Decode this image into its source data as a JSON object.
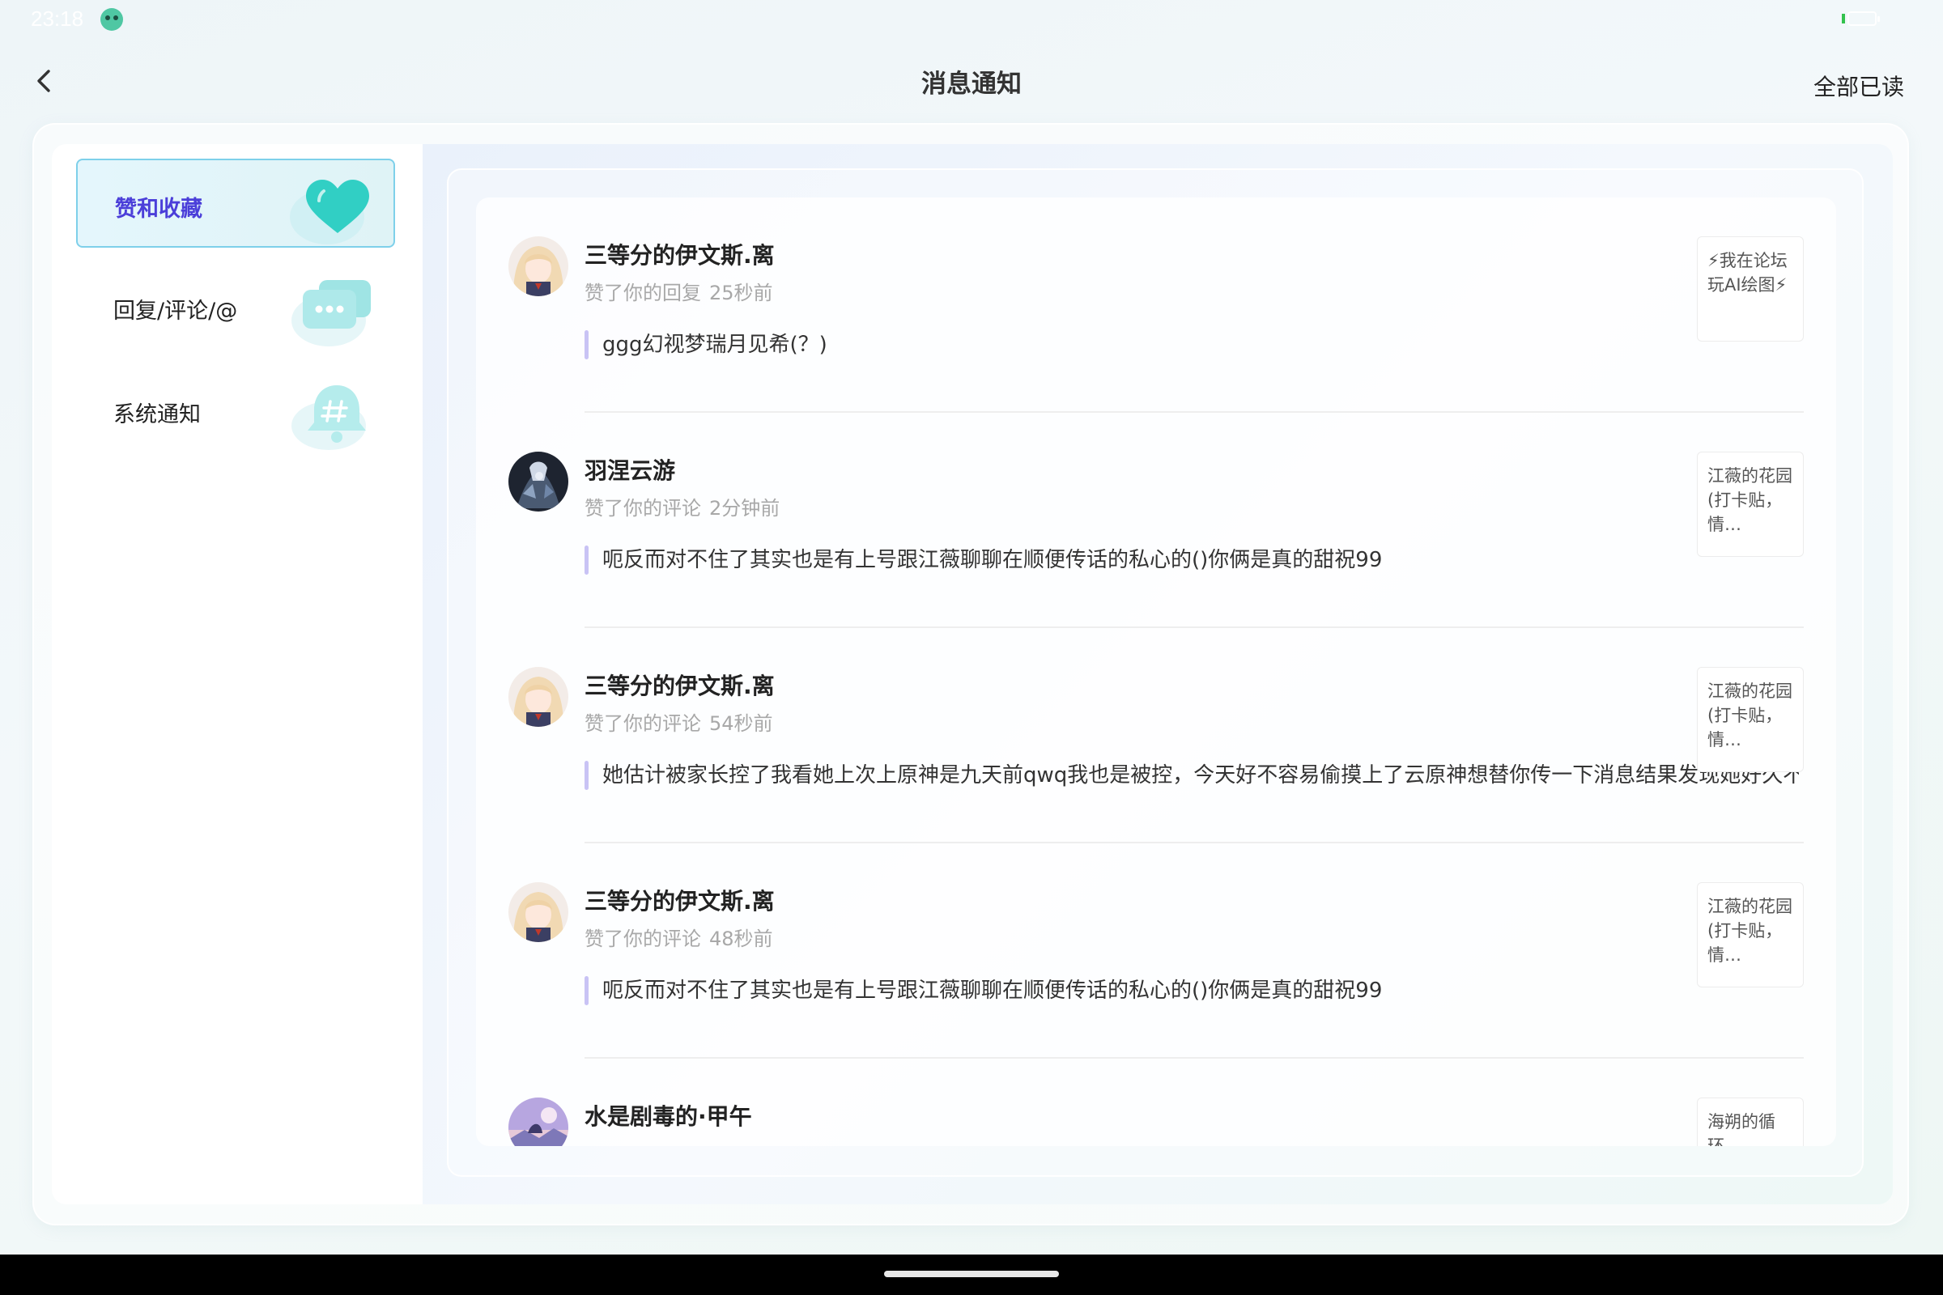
{
  "status_bar": {
    "time": "23:18",
    "app_icon": "green-monster-app-icon",
    "battery_icon": "battery-icon"
  },
  "header": {
    "back_icon": "chevron-left-icon",
    "title": "消息通知",
    "mark_all_read": "全部已读"
  },
  "sidebar": {
    "items": [
      {
        "label": "赞和收藏",
        "icon": "heart-icon",
        "active": true
      },
      {
        "label": "回复/评论/@",
        "icon": "chat-bubbles-icon",
        "active": false
      },
      {
        "label": "系统通知",
        "icon": "bell-icon",
        "active": false
      }
    ]
  },
  "notifications": [
    {
      "user": "三等分的伊文斯.离",
      "action": "赞了你的回复",
      "time": "25秒前",
      "content": "ggg幻视梦瑞月见希(？)",
      "post": "⚡我在论坛玩AI绘图⚡",
      "avatar": "anime-girl-avatar"
    },
    {
      "user": "羽涅云游",
      "action": "赞了你的评论",
      "time": "2分钟前",
      "content": "呃反而对不住了其实也是有上号跟江薇聊聊在顺便传话的私心的()你俩是真的甜祝99",
      "post": "江薇的花园(打卡贴，情…",
      "avatar": "dark-character-avatar"
    },
    {
      "user": "三等分的伊文斯.离",
      "action": "赞了你的评论",
      "time": "54秒前",
      "content": "她估计被家长控了我看她上次上原神是九天前qwq我也是被控，今天好不容易偷摸上了云原神想替你传一下消息结果发现她好久不...",
      "post": "江薇的花园(打卡贴，情…",
      "avatar": "anime-girl-avatar"
    },
    {
      "user": "三等分的伊文斯.离",
      "action": "赞了你的评论",
      "time": "48秒前",
      "content": "呃反而对不住了其实也是有上号跟江薇聊聊在顺便传话的私心的()你俩是真的甜祝99",
      "post": "江薇的花园(打卡贴，情…",
      "avatar": "anime-girl-avatar"
    },
    {
      "user": "水是剧毒的·甲午",
      "action": "",
      "time": "",
      "content": "",
      "post": "海朔的循环…",
      "avatar": "purple-scenery-avatar"
    }
  ],
  "colors": {
    "accent": "#4b3fd9",
    "active_border": "#7ed0ea",
    "quote_bar": "#c9c3f5",
    "meta_text": "#a8a8a8"
  }
}
